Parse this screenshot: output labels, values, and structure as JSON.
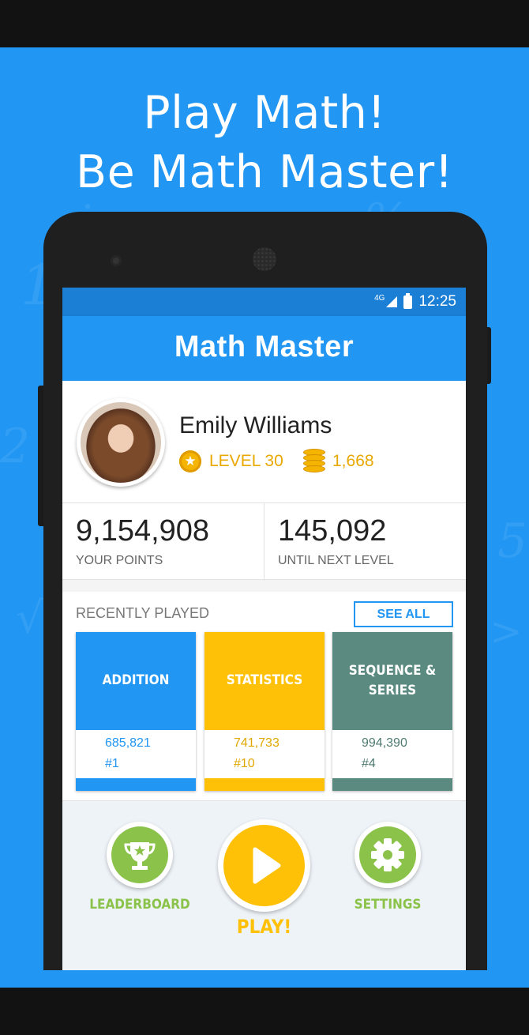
{
  "promo": {
    "headline_line1": "Play Math!",
    "headline_line2": "Be Math Master!",
    "background_color": "#2196f3"
  },
  "status_bar": {
    "network": "4G",
    "time": "12:25"
  },
  "app": {
    "title": "Math Master"
  },
  "profile": {
    "name": "Emily Williams",
    "level": "LEVEL 30",
    "coins": "1,668"
  },
  "stats": {
    "points_value": "9,154,908",
    "points_label": "YOUR POINTS",
    "next_value": "145,092",
    "next_label": "UNTIL NEXT LEVEL"
  },
  "recent": {
    "title": "RECENTLY PLAYED",
    "see_all": "SEE ALL",
    "cards": [
      {
        "name": "ADDITION",
        "score": "685,821",
        "rank": "#1",
        "color": "#2196f3"
      },
      {
        "name": "STATISTICS",
        "score": "741,733",
        "rank": "#10",
        "color": "#ffc107"
      },
      {
        "name_line1": "SEQUENCE &",
        "name_line2": "SERIES",
        "score": "994,390",
        "rank": "#4",
        "color": "#5b8a80"
      }
    ]
  },
  "controls": {
    "leaderboard": "LEADERBOARD",
    "play": "PLAY!",
    "settings": "SETTINGS",
    "green": "#8bc34a",
    "yellow": "#ffc107"
  }
}
